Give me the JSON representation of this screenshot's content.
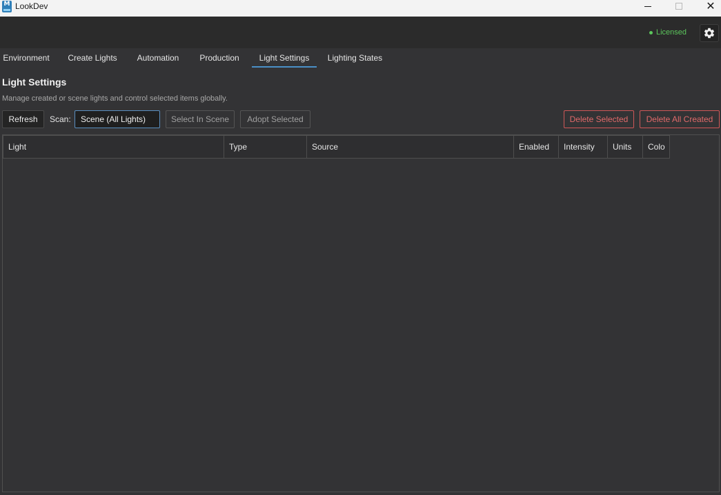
{
  "window": {
    "title": "LookDev",
    "app_icon_letter": "M"
  },
  "status": {
    "license_label": "Licensed",
    "license_color": "#5cc65c",
    "settings_icon": "gear-icon"
  },
  "tabs": [
    {
      "label": "Environment"
    },
    {
      "label": "Create Lights"
    },
    {
      "label": "Automation"
    },
    {
      "label": "Production"
    },
    {
      "label": "Light Settings",
      "active": true
    },
    {
      "label": "Lighting States"
    }
  ],
  "page": {
    "title": "Light Settings",
    "description": "Manage created or scene lights and control selected items globally."
  },
  "toolbar": {
    "refresh_label": "Refresh",
    "scan_label": "Scan:",
    "scan_value": "Scene (All Lights)",
    "select_in_scene_label": "Select In Scene",
    "adopt_selected_label": "Adopt Selected",
    "delete_selected_label": "Delete Selected",
    "delete_all_created_label": "Delete All Created"
  },
  "table": {
    "columns": [
      "Light",
      "Type",
      "Source",
      "Enabled",
      "Intensity",
      "Units",
      "Colo"
    ],
    "rows": []
  },
  "colors": {
    "accent": "#4a90c8",
    "danger": "#e06a6a",
    "background": "#333335"
  }
}
